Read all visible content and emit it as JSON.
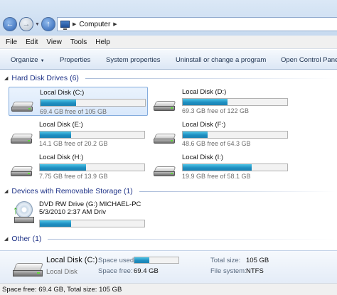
{
  "address": {
    "location": "Computer"
  },
  "menu": [
    "File",
    "Edit",
    "View",
    "Tools",
    "Help"
  ],
  "toolbar": {
    "organize": "Organize",
    "properties": "Properties",
    "system_properties": "System properties",
    "uninstall": "Uninstall or change a program",
    "control_panel": "Open Control Pane"
  },
  "groups": {
    "hard_disks": "Hard Disk Drives (6)",
    "removable": "Devices with Removable Storage (1)",
    "other": "Other (1)"
  },
  "drives": [
    {
      "name": "Local Disk (C:)",
      "free_text": "69.4 GB free of 105 GB",
      "used_fraction": 0.34,
      "selected": true
    },
    {
      "name": "Local Disk (D:)",
      "free_text": "69.3 GB free of 122 GB",
      "used_fraction": 0.43
    },
    {
      "name": "Local Disk (E:)",
      "free_text": "14.1 GB free of 20.2 GB",
      "used_fraction": 0.3
    },
    {
      "name": "Local Disk (F:)",
      "free_text": "48.6 GB free of 64.3 GB",
      "used_fraction": 0.24
    },
    {
      "name": "Local Disk (H:)",
      "free_text": "7.75 GB free of 13.9 GB",
      "used_fraction": 0.44
    },
    {
      "name": "Local Disk (I:)",
      "free_text": "19.9 GB free of 58.1 GB",
      "used_fraction": 0.66
    }
  ],
  "dvd": {
    "line1": "DVD RW Drive (G:) MICHAEL-PC",
    "line2": "5/3/2010 2:37 AM Driv",
    "used_fraction": 0.3
  },
  "details": {
    "name": "Local Disk (C:)",
    "type": "Local Disk",
    "space_used_label": "Space used:",
    "space_free_label": "Space free:",
    "space_free": "69.4 GB",
    "total_size_label": "Total size:",
    "total_size": "105 GB",
    "file_system_label": "File system:",
    "file_system": "NTFS",
    "used_fraction": 0.34
  },
  "status": "Space free: 69.4 GB, Total size: 105 GB"
}
